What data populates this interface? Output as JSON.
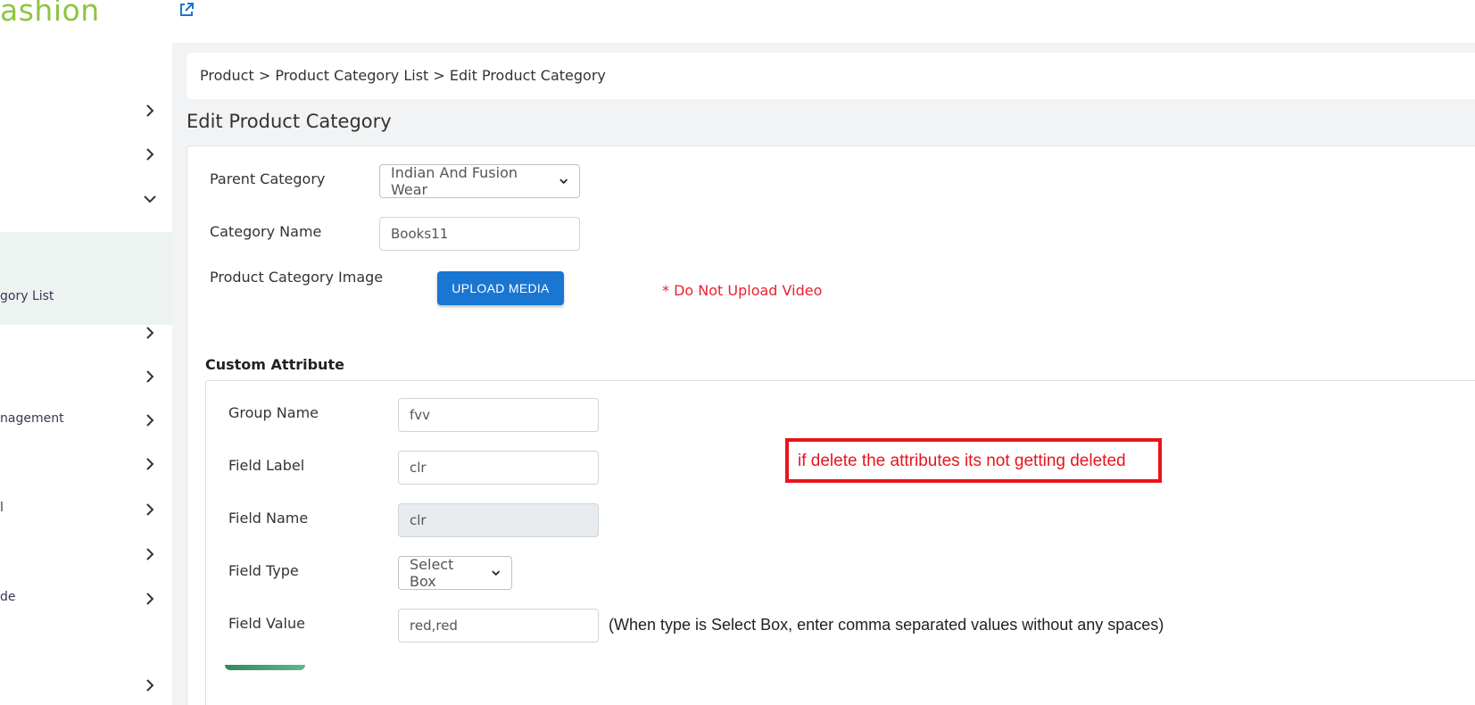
{
  "header": {
    "brand": "ashion",
    "brand_color": "#8cc63f",
    "external_link_icon": "external-link-icon"
  },
  "sidebar": {
    "active_item_label": "gory List",
    "items": [
      {
        "label": "",
        "icon": "chevron-right-icon"
      },
      {
        "label": "",
        "icon": "chevron-right-icon"
      },
      {
        "label": "",
        "icon": "chevron-down-icon"
      },
      {
        "label": "",
        "icon": "chevron-right-icon"
      },
      {
        "label": "",
        "icon": "chevron-right-icon"
      },
      {
        "label": "nagement",
        "icon": "chevron-right-icon"
      },
      {
        "label": "",
        "icon": "chevron-right-icon"
      },
      {
        "label": "l",
        "icon": "chevron-right-icon"
      },
      {
        "label": "",
        "icon": "chevron-right-icon"
      },
      {
        "label": "de",
        "icon": "chevron-right-icon"
      },
      {
        "label": "",
        "icon": "chevron-right-icon"
      }
    ]
  },
  "breadcrumb": "Product > Product Category List > Edit Product Category",
  "page_title": "Edit Product Category",
  "form": {
    "parent_category_label": "Parent Category",
    "parent_category_value": "Indian And Fusion Wear",
    "category_name_label": "Category Name",
    "category_name_value": "Books11",
    "image_label": "Product Category Image",
    "upload_button": "UPLOAD MEDIA",
    "upload_warning": "* Do Not Upload Video"
  },
  "custom_attribute": {
    "title": "Custom Attribute",
    "group_name_label": "Group Name",
    "group_name_value": "fvv",
    "field_label_label": "Field Label",
    "field_label_value": "clr",
    "field_name_label": "Field Name",
    "field_name_value": "clr",
    "field_type_label": "Field Type",
    "field_type_value": "Select Box",
    "field_value_label": "Field Value",
    "field_value_value": "red,red",
    "field_value_hint": "(When type is Select Box, enter comma separated values without any spaces)"
  },
  "annotation": {
    "text": "if delete the attributes its not getting deleted",
    "color": "#e8141c"
  },
  "colors": {
    "primary_button": "#1976d2",
    "warning_text": "#e8232d",
    "active_sidebar_bg": "#edf3f1"
  }
}
